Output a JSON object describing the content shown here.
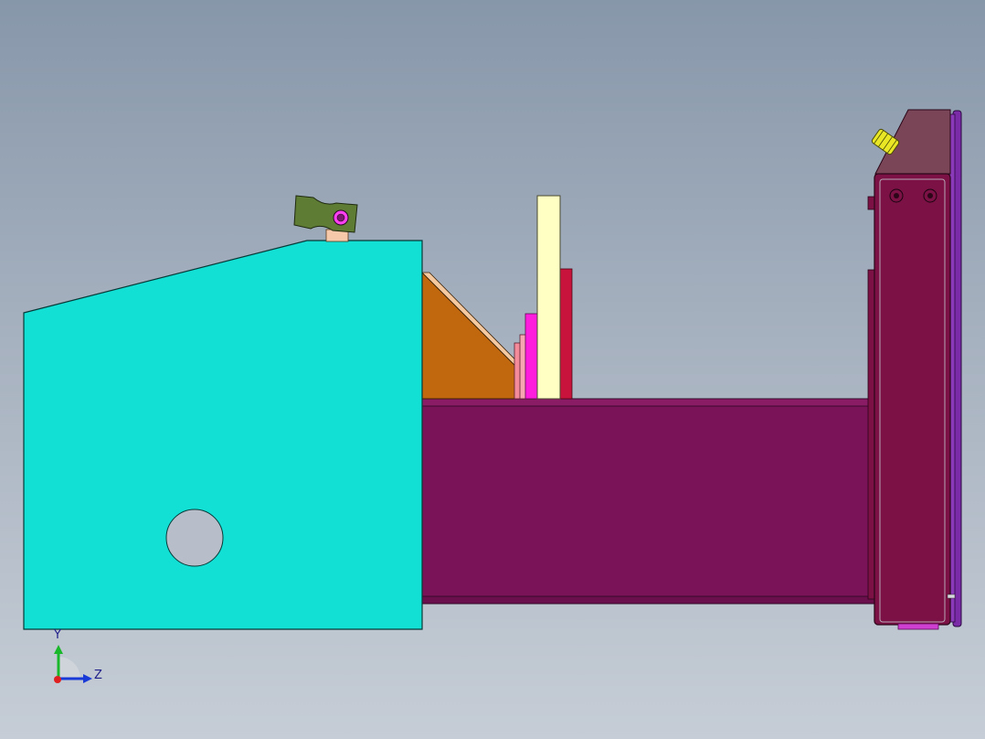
{
  "viewport": {
    "background_top": "#8797aa",
    "background_bottom": "#c6cdd6"
  },
  "model": {
    "colors": {
      "cyan_plate": "#12e0d5",
      "purple_beam": "#7a1358",
      "maroon_end_plate": "#7b1144",
      "orange_gusset": "#c1680f",
      "cream_bar": "#ffffc4",
      "red_bar": "#c8143c",
      "magenta_block": "#ff1ddd",
      "pink_block": "#f38b9b",
      "green_clamp": "#5f7c34",
      "yellow_knob": "#e8e625",
      "violet_edge": "#7b2aa8",
      "dark_hole": "#b8bdc7"
    }
  },
  "triad": {
    "y_label": "Y",
    "z_label": "Z"
  }
}
